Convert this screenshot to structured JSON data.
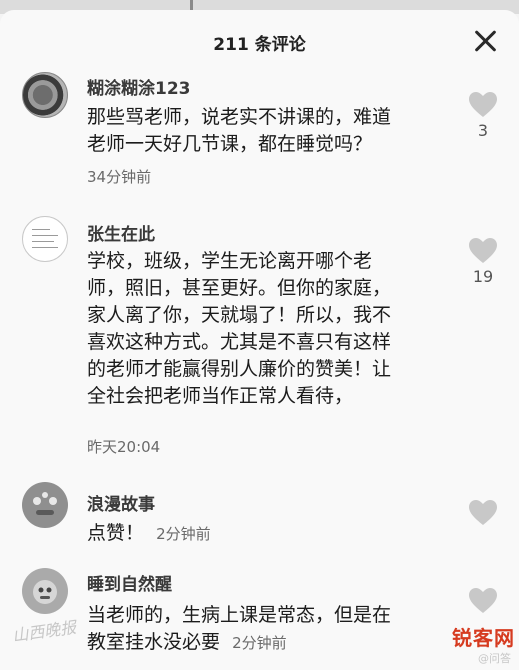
{
  "header": {
    "title": "211 条评论"
  },
  "comments": [
    {
      "username": "糊涂糊涂123",
      "lines": [
        "那些骂老师，说老实不讲课的，难道",
        "老师一天好几节课，都在睡觉吗？"
      ],
      "time": "34分钟前",
      "likes": "3"
    },
    {
      "username": "张生在此",
      "lines": [
        "学校，班级，学生无论离开哪个老",
        "师，照旧，甚至更好。但你的家庭，",
        "家人离了你，天就塌了！所以，我不",
        "喜欢这种方式。尤其是不喜只有这样",
        "的老师才能赢得别人廉价的赞美！让",
        "全社会把老师当作正常人看待，"
      ],
      "time": "昨天20:04",
      "likes": "19"
    },
    {
      "username": "浪漫故事",
      "lines": [
        "点赞！"
      ],
      "time": "2分钟前",
      "likes": ""
    },
    {
      "username": "睡到自然醒",
      "lines": [
        "当老师的，生病上课是常态，但是在",
        "教室挂水没必要"
      ],
      "time": "2分钟前",
      "likes": ""
    }
  ],
  "watermark": {
    "left_text": "山西晚报",
    "logo_text": "锐客网",
    "sub_text": "@问答"
  },
  "colors": {
    "heart": "#c8c8c8",
    "logo": "#d63b20"
  }
}
